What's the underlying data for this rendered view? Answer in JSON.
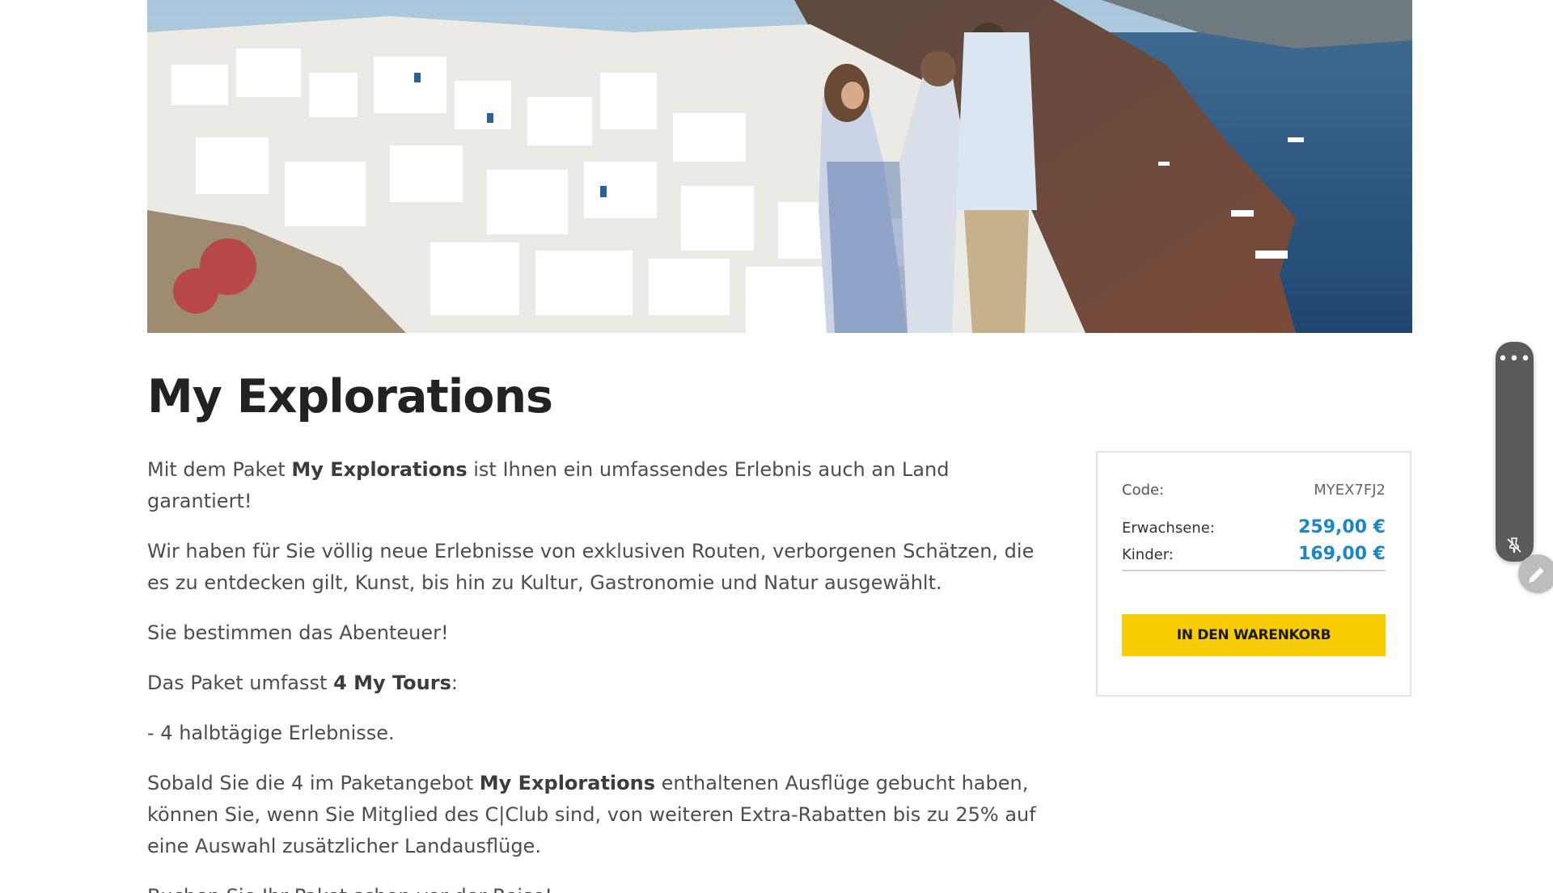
{
  "page": {
    "title": "My Explorations"
  },
  "hero": {
    "image_icon": "santorini-couple-photo"
  },
  "description": {
    "p1_pre": "Mit dem Paket ",
    "p1_bold": "My Explorations",
    "p1_post": " ist Ihnen ein umfassendes Erlebnis auch an Land garantiert!",
    "p2": "Wir haben für Sie völlig neue Erlebnisse von exklusiven Routen, verborgenen Schätzen, die es zu entdecken gilt, Kunst, bis hin zu Kultur, Gastronomie und Natur ausgewählt.",
    "p3": "Sie bestimmen das Abenteuer!",
    "p4_pre": "Das Paket umfasst ",
    "p4_bold": "4 My Tours",
    "p4_post": ":",
    "p5": "- 4 halbtägige Erlebnisse.",
    "p6_pre": "Sobald Sie die 4 im Paketangebot ",
    "p6_bold": "My Explorations",
    "p6_post": " enthaltenen Ausflüge gebucht haben, können Sie, wenn Sie Mitglied des C|Club sind, von weiteren Extra-Rabatten bis zu 25% auf eine Auswahl zusätzlicher Landausflüge.",
    "p7": "Buchen Sie Ihr Paket schon vor der Reise!"
  },
  "booking": {
    "code_label": "Code:",
    "code_value": "MYEX7FJ2",
    "adult_label": "Erwachsene:",
    "adult_price": "259,00 €",
    "child_label": "Kinder:",
    "child_price": "169,00 €",
    "cart_button": "IN DEN WARENKORB",
    "accent_color": "#1a86c8",
    "button_color": "#f8cc00"
  },
  "tools": {
    "menu_icon": "more-dots-icon",
    "pin_icon": "unpin-icon",
    "edit_icon": "pencil-icon"
  }
}
